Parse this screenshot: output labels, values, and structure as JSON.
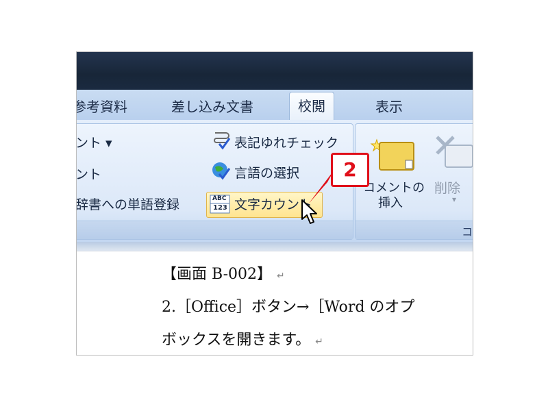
{
  "tabs": [
    "参考資料",
    "差し込み文書",
    "校閲",
    "表示"
  ],
  "active_tab": "校閲",
  "proofing": {
    "item1_label": "ント ▾",
    "item2_label": "ント",
    "item3_label": "辞書への単語登録",
    "notation_check_label": "表記ゆれチェック",
    "language_label": "言語の選択",
    "word_count_label": "文字カウント",
    "word_count_icon_top": "ABC",
    "word_count_icon_bottom": "123"
  },
  "comments": {
    "insert_label_line1": "コメントの",
    "insert_label_line2": "挿入",
    "delete_label": "削除",
    "group_label_partial": "コ"
  },
  "callout": {
    "number": "2"
  },
  "document": {
    "line1": "【画面 B-002】",
    "line2": "2.［Office］ボタン→［Word のオプ",
    "line3": "ボックスを開きます。",
    "para_mark": "↵"
  },
  "colors": {
    "callout_red": "#e0101a",
    "title_bar": "#182638",
    "ribbon_blue": "#cfe0f5"
  }
}
